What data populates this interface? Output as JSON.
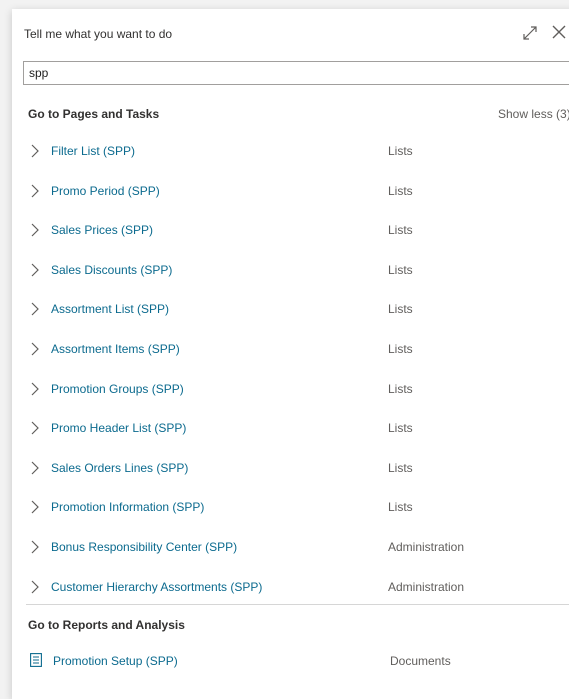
{
  "header": {
    "title": "Tell me what you want to do"
  },
  "search": {
    "value": "spp"
  },
  "pages_section": {
    "heading": "Go to Pages and Tasks",
    "show_less": "Show less (3)",
    "items": [
      {
        "label": "Filter List (SPP)",
        "category": "Lists"
      },
      {
        "label": "Promo Period (SPP)",
        "category": "Lists"
      },
      {
        "label": "Sales Prices (SPP)",
        "category": "Lists"
      },
      {
        "label": "Sales Discounts (SPP)",
        "category": "Lists"
      },
      {
        "label": "Assortment List (SPP)",
        "category": "Lists"
      },
      {
        "label": "Assortment Items (SPP)",
        "category": "Lists"
      },
      {
        "label": "Promotion Groups (SPP)",
        "category": "Lists"
      },
      {
        "label": "Promo Header List (SPP)",
        "category": "Lists"
      },
      {
        "label": "Sales Orders Lines (SPP)",
        "category": "Lists"
      },
      {
        "label": "Promotion Information (SPP)",
        "category": "Lists"
      },
      {
        "label": "Bonus Responsibility Center (SPP)",
        "category": "Administration"
      },
      {
        "label": "Customer Hierarchy Assortments (SPP)",
        "category": "Administration"
      }
    ]
  },
  "reports_section": {
    "heading": "Go to Reports and Analysis",
    "items": [
      {
        "label": "Promotion Setup (SPP)",
        "category": "Documents"
      }
    ]
  },
  "icons": {
    "expand": "expand-icon",
    "close": "close-icon",
    "chevron": "chevron-right-icon",
    "document": "document-icon"
  },
  "colors": {
    "link": "#0b6a8e",
    "muted": "#605e5c",
    "border": "#a19f9d"
  }
}
